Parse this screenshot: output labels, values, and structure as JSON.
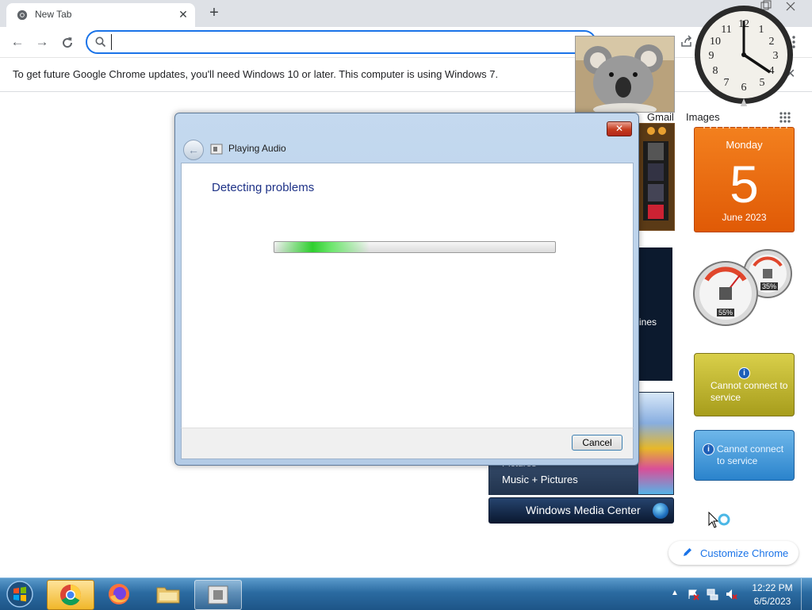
{
  "browser": {
    "tab_title": "New Tab",
    "new_tab_label": "+",
    "omnibox_value": "",
    "infobar_text": "To get future Google Chrome updates, you'll need Windows 10 or later. This computer is using Windows 7.",
    "infobar_close": "✕"
  },
  "ntp": {
    "gmail": "Gmail",
    "images": "Images",
    "customize": "Customize Chrome"
  },
  "gadgets": {
    "calendar": {
      "day": "Monday",
      "date": "5",
      "month": "June 2023"
    },
    "cpu_meter": {
      "cpu": "55%",
      "memory": "35%"
    },
    "weather_text": "Cannot connect to service",
    "currency_text": "Cannot connect to service",
    "clock_time": "4:00",
    "media_center": {
      "dark_tile_label": "ines",
      "pictures_sub": "Pictures",
      "pictures_label": "Music + Pictures",
      "bar_label": "Windows Media Center"
    }
  },
  "dialog": {
    "title": "Playing Audio",
    "heading": "Detecting problems",
    "cancel_label": "Cancel",
    "progress": "indeterminate",
    "close_label": "✕"
  },
  "taskbar": {
    "time": "12:22 PM",
    "date": "6/5/2023",
    "pinned": [
      "Google Chrome",
      "Firefox",
      "Windows Explorer",
      "Troubleshooting"
    ]
  },
  "colors": {
    "accent": "#1a73e8",
    "dialog_heading": "#1e3287",
    "calendar": "#e96a10",
    "progress_glow": "#2fcf2f"
  }
}
